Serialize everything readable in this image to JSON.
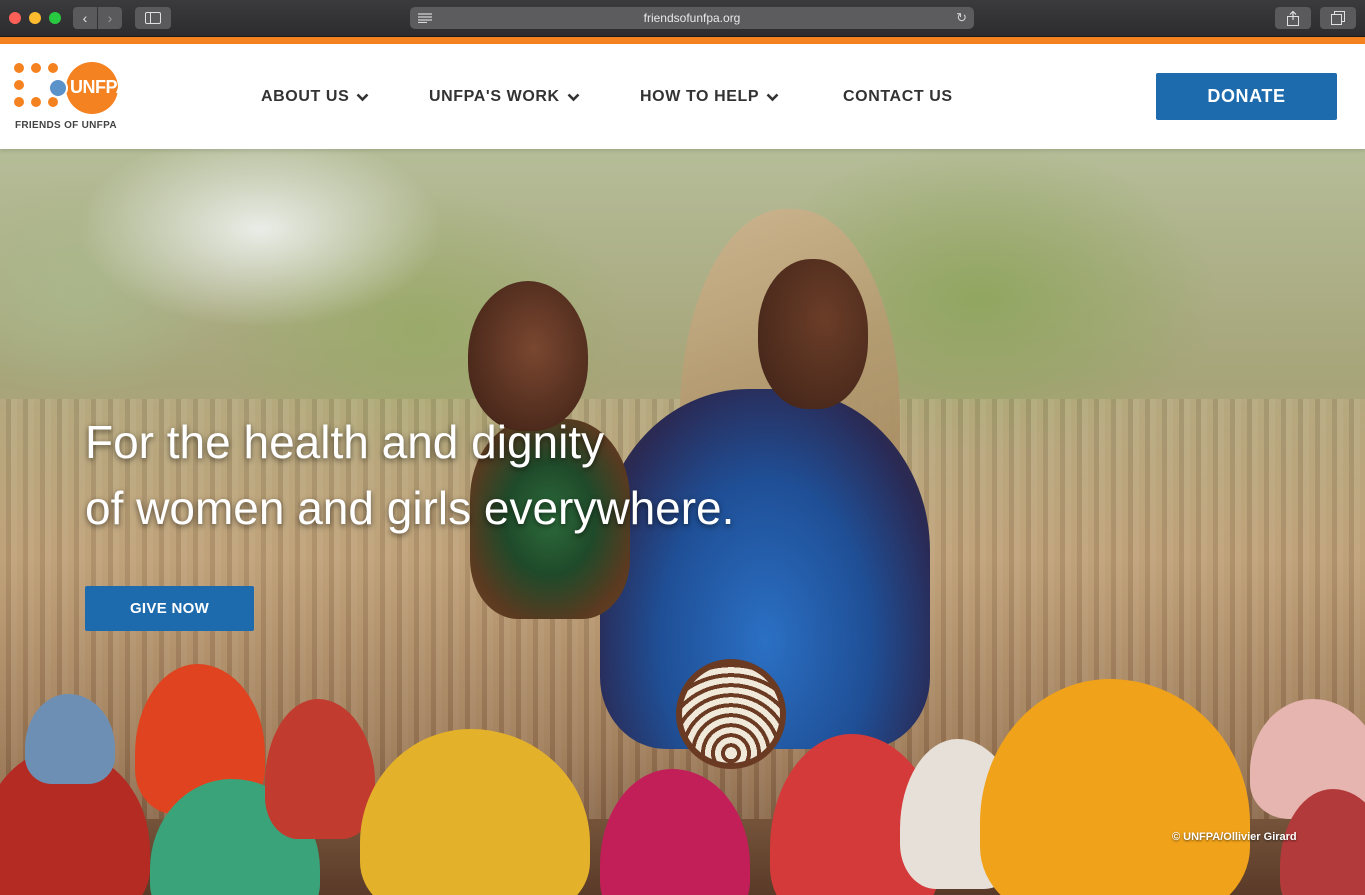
{
  "browser": {
    "url": "friendsofunfpa.org",
    "icons": {
      "close": "close-dot",
      "minimize": "minimize-dot",
      "maximize": "maximize-dot",
      "back": "chevron-left-icon",
      "forward": "chevron-right-icon",
      "sidebar": "sidebar-icon",
      "reader": "reader-icon",
      "reload": "reload-icon",
      "share": "share-icon",
      "tabs": "tabs-icon"
    }
  },
  "colors": {
    "accent_orange": "#f58220",
    "button_blue": "#1d6aad",
    "nav_text": "#333333"
  },
  "header": {
    "logo": {
      "wordmark": "UNFPA",
      "subtitle": "FRIENDS OF UNFPA"
    },
    "nav": [
      {
        "label": "ABOUT US",
        "has_dropdown": true
      },
      {
        "label": "UNFPA'S WORK",
        "has_dropdown": true
      },
      {
        "label": "HOW TO HELP",
        "has_dropdown": true
      },
      {
        "label": "CONTACT US",
        "has_dropdown": false
      }
    ],
    "donate_label": "DONATE"
  },
  "hero": {
    "headline_line1": "For the health and dignity",
    "headline_line2": "of women and girls everywhere.",
    "cta_label": "GIVE NOW",
    "photo_credit": "© UNFPA/Ollivier Girard"
  }
}
